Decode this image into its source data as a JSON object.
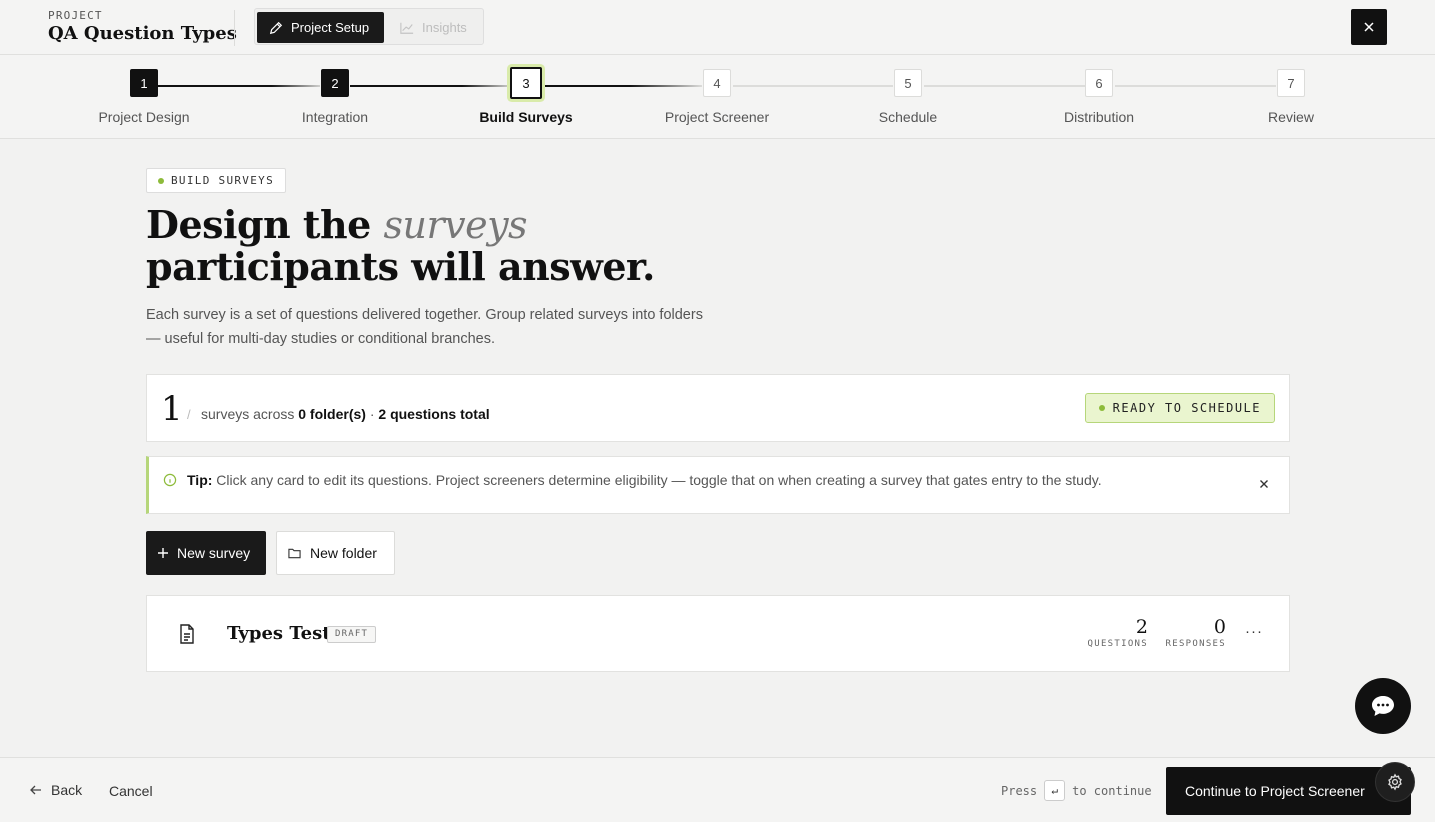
{
  "header": {
    "eyebrow": "PROJECT",
    "title": "QA Question Types",
    "tabs": [
      {
        "label": "Project Setup",
        "icon": "pencil-icon",
        "state": "active"
      },
      {
        "label": "Insights",
        "icon": "chart-icon",
        "state": "disabled"
      }
    ],
    "close_icon": "close-icon"
  },
  "stepper": {
    "steps": [
      {
        "num": "1",
        "label": "Project Design",
        "state": "done"
      },
      {
        "num": "2",
        "label": "Integration",
        "state": "done"
      },
      {
        "num": "3",
        "label": "Build Surveys",
        "state": "current"
      },
      {
        "num": "4",
        "label": "Project Screener",
        "state": "todo"
      },
      {
        "num": "5",
        "label": "Schedule",
        "state": "todo"
      },
      {
        "num": "6",
        "label": "Distribution",
        "state": "todo"
      },
      {
        "num": "7",
        "label": "Review",
        "state": "todo"
      }
    ]
  },
  "main": {
    "pill": "BUILD SURVEYS",
    "headline": {
      "before": "Design the ",
      "emphasis": "surveys",
      "after": " participants will answer."
    },
    "subtext": "Each survey is a set of questions delivered together. Group related surveys into folders — useful for multi-day studies or conditional branches.",
    "stats": {
      "count": "1",
      "slash": "/",
      "text_prefix": "surveys across",
      "folders": "0 folder(s)",
      "separator": "·",
      "questions": "2 questions total",
      "badge": "READY TO SCHEDULE"
    },
    "tip": {
      "label": "Tip:",
      "text": "Click any card to edit its questions. Project screeners determine eligibility — toggle that on when creating a survey that gates entry to the study."
    },
    "actions": {
      "new_survey": "New survey",
      "new_folder": "New folder"
    },
    "surveys": [
      {
        "name": "Types Test",
        "status": "DRAFT",
        "questions": "2",
        "questions_label": "QUESTIONS",
        "responses": "0",
        "responses_label": "RESPONSES",
        "more": "···"
      }
    ]
  },
  "footer": {
    "back": "Back",
    "cancel": "Cancel",
    "hint_press": "Press",
    "hint_key": "↵",
    "hint_continue": "to continue",
    "continue": "Continue to Project Screener"
  },
  "colors": {
    "accent": "#b6d67a",
    "accent_bg": "#eaf5cf",
    "dark": "#111111",
    "background": "#f2f2f1"
  }
}
